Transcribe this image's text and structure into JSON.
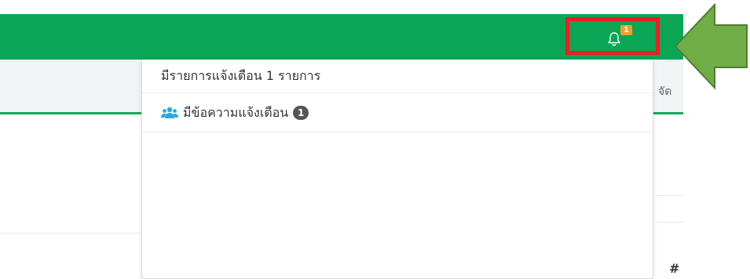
{
  "navbar": {
    "notification_count": "1",
    "bell_icon": "bell-icon"
  },
  "subbar": {
    "right_text": "จัด"
  },
  "dropdown": {
    "header": "มีรายการแจ้งเตือน 1 รายการ",
    "items": [
      {
        "icon": "users-icon",
        "label": "มีข้อความแจ้งเตือน",
        "badge": "1"
      }
    ]
  },
  "background": {
    "hash_text": "#"
  },
  "colors": {
    "navbar": "#0aa655",
    "highlight_box": "#ee1c24",
    "arrow": "#70ad47",
    "badge": "#f0a020",
    "users_icon": "#29a8e0"
  }
}
